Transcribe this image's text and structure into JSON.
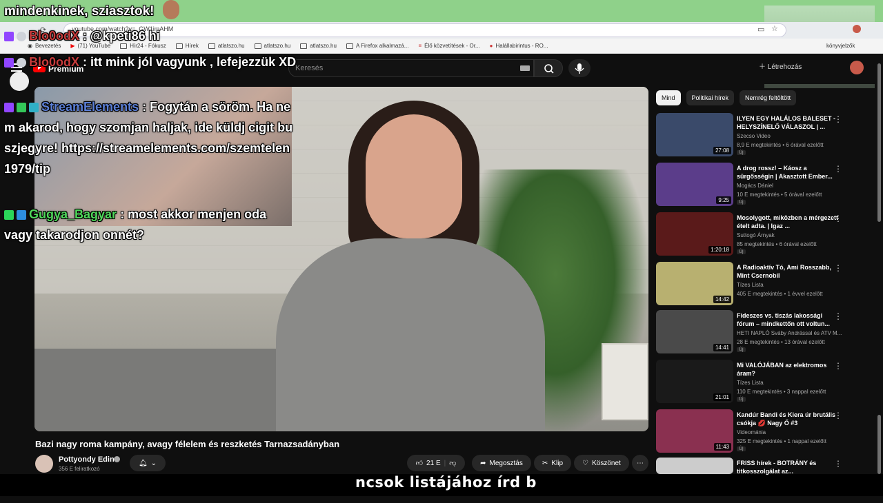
{
  "browser": {
    "url": "youtube.com/watch?v=_GW1imAHM",
    "bookmarks": [
      {
        "label": "Bevezetés"
      },
      {
        "label": "(71) YouTube"
      },
      {
        "label": "Hír24 - Fókusz"
      },
      {
        "label": "Hírek"
      },
      {
        "label": "atlatszo.hu"
      },
      {
        "label": "atlatszo.hu"
      },
      {
        "label": "atlatszo.hu"
      },
      {
        "label": "A Firefox alkalmazá..."
      },
      {
        "label": "Élő közvetítések - Or..."
      },
      {
        "label": "Halállabirintus - RO..."
      }
    ],
    "bookmarks_right": "könyvjelzők"
  },
  "youtube": {
    "brand": "Premium",
    "search_placeholder": "Keresés",
    "create_label": "Létrehozás"
  },
  "chat": [
    {
      "name": "",
      "text": "mindenkinek, sziasztok!"
    },
    {
      "name": "Blo0odX",
      "text": ": @kpeti86 hi"
    },
    {
      "name": "Blo0odX",
      "text": ": itt mink jól vagyunk , lefejezzük XD"
    },
    {
      "name": "StreamElements",
      "text": ": Fogytán a söröm. Ha nem akarod, hogy szomjan haljak, ide küldj cigit buszjegyre! https://streamelements.com/szemtelen1979/tip"
    },
    {
      "name": "Gugya_Bagyar",
      "text": ": most akkor menjen oda vagy takarodjon onnét?"
    }
  ],
  "video": {
    "title": "Bazi nagy roma kampány, avagy félelem és reszketés Tarnazsadányban",
    "channel": "Pottyondy Edina",
    "subscribers": "356 E feliratkozó",
    "likes": "21 E",
    "share_label": "Megosztás",
    "clip_label": "Klip",
    "thanks_label": "Köszönet",
    "caption": "ncsok listájához írd b"
  },
  "sidebar": {
    "chips": [
      "Mind",
      "Politikai hírek",
      "Nemrég feltöltött"
    ],
    "items": [
      {
        "title": "ILYEN EGY HALÁLOS BALESET - HELYSZÍNELŐ VÁLASZOL | ...",
        "channel": "Szecso Video",
        "meta": "8,9 E megtekintés • 6 órával ezelőtt",
        "duration": "27:08",
        "new": "Új",
        "color": "#3a4a6a"
      },
      {
        "title": "A drog rossz! – Káosz a sürgősségin | Akasztott Ember...",
        "channel": "Mogács Dániel",
        "meta": "10 E megtekintés • 5 órával ezelőtt",
        "duration": "9:25",
        "new": "Új",
        "color": "#5b3d8a"
      },
      {
        "title": "Mosolygott, miközben a mérgezett ételt adta. | Igaz ...",
        "channel": "Suttogó Árnyak",
        "meta": "85 megtekintés • 6 órával ezelőtt",
        "duration": "1:20:18",
        "new": "Új",
        "color": "#5a1a1a"
      },
      {
        "title": "A Radioaktív Tó, Ami Rosszabb, Mint Csernobil",
        "channel": "Tízes Lista",
        "meta": "405 E megtekintés • 1 évvel ezelőtt",
        "duration": "14:42",
        "new": "",
        "color": "#b8b070"
      },
      {
        "title": "Fideszes vs. tiszás lakossági fórum – mindkettőn ott voltun...",
        "channel": "HETI NAPLÓ Sváby Andrással és ATV M...",
        "meta": "28 E megtekintés • 13 órával ezelőtt",
        "duration": "14:41",
        "new": "Új",
        "color": "#4a4a4a"
      },
      {
        "title": "Mi VALÓJÁBAN az elektromos áram?",
        "channel": "Tízes Lista",
        "meta": "110 E megtekintés • 3 nappal ezelőtt",
        "duration": "21:01",
        "new": "Új",
        "color": "#1a1a1a"
      },
      {
        "title": "Kandúr Bandi és Kiera úr brutális csókja 💋 Nagy Ő #3",
        "channel": "Videománia",
        "meta": "325 E megtekintés • 1 nappal ezelőtt",
        "duration": "11:43",
        "new": "Új",
        "color": "#8a3050"
      },
      {
        "title": "FRISS hírek - BOTRÁNY és titkosszolgálat az...",
        "channel": "",
        "meta": "",
        "duration": "",
        "new": "",
        "color": "#cccccc"
      }
    ]
  }
}
